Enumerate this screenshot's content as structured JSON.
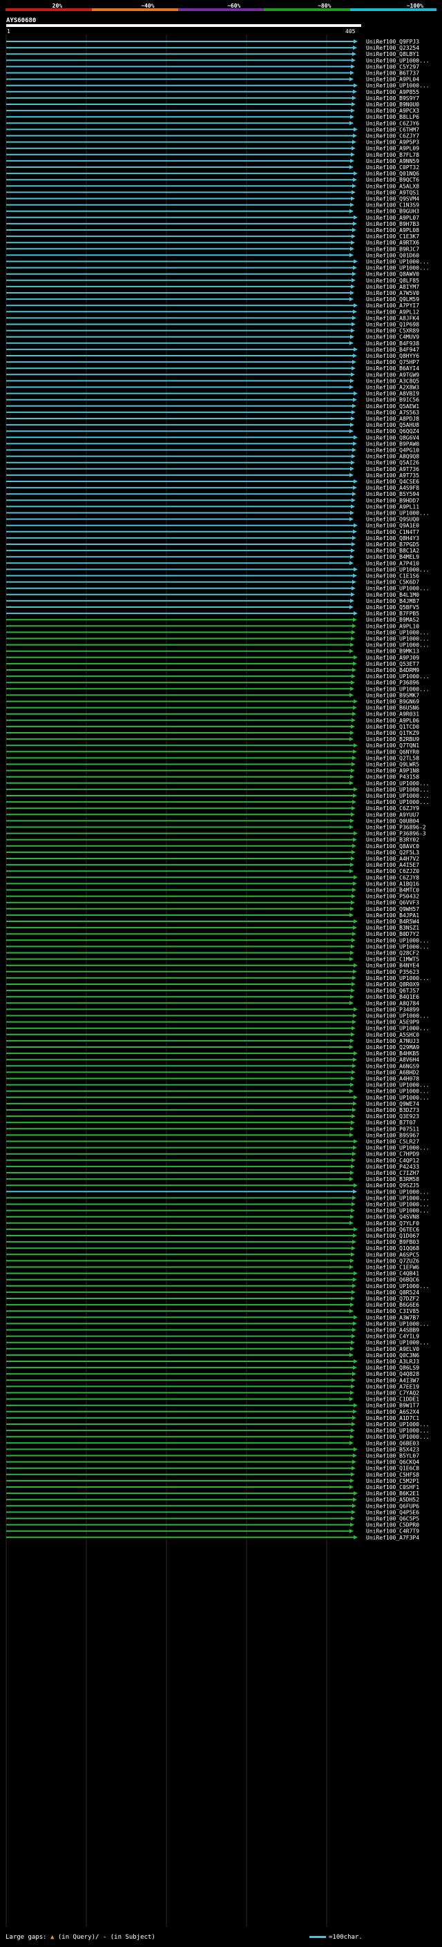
{
  "scale": {
    "labels": [
      "20%",
      "~40%",
      "~60%",
      "~80%",
      "~100%"
    ],
    "colors": [
      "#d01818",
      "#e07818",
      "#7a2aa8",
      "#18a018",
      "#18b8d8"
    ]
  },
  "query": {
    "name": "AYS60680",
    "start": "1",
    "end": "405"
  },
  "legend": {
    "text": "Large gaps:",
    "query_gap": "(in Query)/",
    "subject_gap": "- (in Subject)",
    "key": "=100char."
  },
  "hit_colors": {
    "high": "#4cc3d6",
    "mid": "#2bb83a"
  },
  "hits": [
    {
      "id": "UniRef100_Q9FPJ3",
      "c": "high"
    },
    {
      "id": "UniRef100_Q23254",
      "c": "high"
    },
    {
      "id": "UniRef100_Q8LBY1",
      "c": "high"
    },
    {
      "id": "UniRef100_UP1000...",
      "c": "high"
    },
    {
      "id": "UniRef100_C5Y297",
      "c": "high"
    },
    {
      "id": "UniRef100_B6T737",
      "c": "high"
    },
    {
      "id": "UniRef100_A9PL04",
      "c": "high"
    },
    {
      "id": "UniRef100_UP1000...",
      "c": "high"
    },
    {
      "id": "UniRef100_A9P855",
      "c": "high"
    },
    {
      "id": "UniRef100_B9S9Y7",
      "c": "high"
    },
    {
      "id": "UniRef100_B9N0U0",
      "c": "high"
    },
    {
      "id": "UniRef100_A9PCX3",
      "c": "high"
    },
    {
      "id": "UniRef100_B8LLP6",
      "c": "high"
    },
    {
      "id": "UniRef100_C6ZJY6",
      "c": "high"
    },
    {
      "id": "UniRef100_C6THM7",
      "c": "high"
    },
    {
      "id": "UniRef100_C6ZJY7",
      "c": "high"
    },
    {
      "id": "UniRef100_A9P5P3",
      "c": "high"
    },
    {
      "id": "UniRef100_A9PL09",
      "c": "high"
    },
    {
      "id": "UniRef100_B7FL78",
      "c": "high"
    },
    {
      "id": "UniRef100_A9NN59",
      "c": "high"
    },
    {
      "id": "UniRef100_C0PT32",
      "c": "high"
    },
    {
      "id": "UniRef100_Q01NQ6",
      "c": "high"
    },
    {
      "id": "UniRef100_B9QCT6",
      "c": "high"
    },
    {
      "id": "UniRef100_A5ALX8",
      "c": "high"
    },
    {
      "id": "UniRef100_A9TQS1",
      "c": "high"
    },
    {
      "id": "UniRef100_Q9SVM4",
      "c": "high"
    },
    {
      "id": "UniRef100_C1N3S9",
      "c": "high"
    },
    {
      "id": "UniRef100_B9GUH3",
      "c": "high"
    },
    {
      "id": "UniRef100_A9PL07",
      "c": "high"
    },
    {
      "id": "UniRef100_B9H7B3",
      "c": "high"
    },
    {
      "id": "UniRef100_A9PL08",
      "c": "high"
    },
    {
      "id": "UniRef100_C1E3K7",
      "c": "high"
    },
    {
      "id": "UniRef100_A9RTX6",
      "c": "high"
    },
    {
      "id": "UniRef100_B9RJC7",
      "c": "high"
    },
    {
      "id": "UniRef100_Q01D60",
      "c": "high"
    },
    {
      "id": "UniRef100_UP1000...",
      "c": "high"
    },
    {
      "id": "UniRef100_UP1000...",
      "c": "high"
    },
    {
      "id": "UniRef100_Q8AWV0",
      "c": "high"
    },
    {
      "id": "UniRef100_Q8LF85",
      "c": "high"
    },
    {
      "id": "UniRef100_A8IYM7",
      "c": "high"
    },
    {
      "id": "UniRef100_A7W5V0",
      "c": "high"
    },
    {
      "id": "UniRef100_Q9LM59",
      "c": "high"
    },
    {
      "id": "UniRef100_A7PYI7",
      "c": "high"
    },
    {
      "id": "UniRef100_A9PL12",
      "c": "high"
    },
    {
      "id": "UniRef100_A8JFK4",
      "c": "high"
    },
    {
      "id": "UniRef100_Q1P698",
      "c": "high"
    },
    {
      "id": "UniRef100_C5XR89",
      "c": "high"
    },
    {
      "id": "UniRef100_C4MUV9",
      "c": "high"
    },
    {
      "id": "UniRef100_B4F938",
      "c": "high"
    },
    {
      "id": "UniRef100_B4F947",
      "c": "high"
    },
    {
      "id": "UniRef100_Q8HYY6",
      "c": "high"
    },
    {
      "id": "UniRef100_Q75HP7",
      "c": "high"
    },
    {
      "id": "UniRef100_B6AYI4",
      "c": "high"
    },
    {
      "id": "UniRef100_A9TGW9",
      "c": "high"
    },
    {
      "id": "UniRef100_A3C8Q5",
      "c": "high"
    },
    {
      "id": "UniRef100_A2X8W3",
      "c": "high"
    },
    {
      "id": "UniRef100_A8VBI9",
      "c": "high"
    },
    {
      "id": "UniRef100_B9IC56",
      "c": "high"
    },
    {
      "id": "UniRef100_Q5AEW1",
      "c": "high"
    },
    {
      "id": "UniRef100_A7S563",
      "c": "high"
    },
    {
      "id": "UniRef100_A8PDJ8",
      "c": "high"
    },
    {
      "id": "UniRef100_Q5AHU8",
      "c": "high"
    },
    {
      "id": "UniRef100_Q6QQZ4",
      "c": "high"
    },
    {
      "id": "UniRef100_Q8G6V4",
      "c": "high"
    },
    {
      "id": "UniRef100_B9PAW0",
      "c": "high"
    },
    {
      "id": "UniRef100_Q4PG10",
      "c": "high"
    },
    {
      "id": "UniRef100_A8Q9Q8",
      "c": "high"
    },
    {
      "id": "UniRef100_Q5AI26",
      "c": "high"
    },
    {
      "id": "UniRef100_A9T736",
      "c": "high"
    },
    {
      "id": "UniRef100_A9T735",
      "c": "high"
    },
    {
      "id": "UniRef100_Q4CSE6",
      "c": "high"
    },
    {
      "id": "UniRef100_A4S9F8",
      "c": "high"
    },
    {
      "id": "UniRef100_B5Y594",
      "c": "high"
    },
    {
      "id": "UniRef100_B9HDD7",
      "c": "high"
    },
    {
      "id": "UniRef100_A9PL11",
      "c": "high"
    },
    {
      "id": "UniRef100_UP1000...",
      "c": "high"
    },
    {
      "id": "UniRef100_Q9SUQ0",
      "c": "high"
    },
    {
      "id": "UniRef100_Q9A1E0",
      "c": "high"
    },
    {
      "id": "UniRef100_C1N4T7",
      "c": "high"
    },
    {
      "id": "UniRef100_Q8H4Y3",
      "c": "high"
    },
    {
      "id": "UniRef100_B7PGD5",
      "c": "high"
    },
    {
      "id": "UniRef100_B8C1A2",
      "c": "high"
    },
    {
      "id": "UniRef100_B4MEL9",
      "c": "high"
    },
    {
      "id": "UniRef100_A7P410",
      "c": "high"
    },
    {
      "id": "UniRef100_UP1000...",
      "c": "high"
    },
    {
      "id": "UniRef100_C1E1S6",
      "c": "high"
    },
    {
      "id": "UniRef100_C5K6D7",
      "c": "high"
    },
    {
      "id": "UniRef100_UP1000...",
      "c": "high"
    },
    {
      "id": "UniRef100_B4L1M0",
      "c": "high"
    },
    {
      "id": "UniRef100_B4JM87",
      "c": "high"
    },
    {
      "id": "UniRef100_Q5BFV5",
      "c": "high"
    },
    {
      "id": "UniRef100_B7FPB5",
      "c": "high"
    },
    {
      "id": "UniRef100_B9MAS2",
      "c": "mid"
    },
    {
      "id": "UniRef100_A9PL10",
      "c": "mid"
    },
    {
      "id": "UniRef100_UP1000...",
      "c": "mid"
    },
    {
      "id": "UniRef100_UP1000...",
      "c": "mid"
    },
    {
      "id": "UniRef100_UP1000...",
      "c": "mid"
    },
    {
      "id": "UniRef100_B9MK13",
      "c": "mid"
    },
    {
      "id": "UniRef100_A9PJ09",
      "c": "mid"
    },
    {
      "id": "UniRef100_Q53ET7",
      "c": "mid"
    },
    {
      "id": "UniRef100_B4DRM9",
      "c": "mid"
    },
    {
      "id": "UniRef100_UP1000...",
      "c": "mid"
    },
    {
      "id": "UniRef100_P36896",
      "c": "mid"
    },
    {
      "id": "UniRef100_UP1000...",
      "c": "mid"
    },
    {
      "id": "UniRef100_B9SMK7",
      "c": "mid"
    },
    {
      "id": "UniRef100_B9GN69",
      "c": "mid"
    },
    {
      "id": "UniRef100_B6U5N6",
      "c": "mid"
    },
    {
      "id": "UniRef100_A9R031",
      "c": "mid"
    },
    {
      "id": "UniRef100_A9PL06",
      "c": "mid"
    },
    {
      "id": "UniRef100_Q1TCD0",
      "c": "mid"
    },
    {
      "id": "UniRef100_Q1TKZ9",
      "c": "mid"
    },
    {
      "id": "UniRef100_B2RBU9",
      "c": "mid"
    },
    {
      "id": "UniRef100_Q7TQN1",
      "c": "mid"
    },
    {
      "id": "UniRef100_Q6NYR0",
      "c": "mid"
    },
    {
      "id": "UniRef100_Q2TL58",
      "c": "mid"
    },
    {
      "id": "UniRef100_Q9LWR5",
      "c": "mid"
    },
    {
      "id": "UniRef100_A9P1N8",
      "c": "mid"
    },
    {
      "id": "UniRef100_P43158",
      "c": "mid"
    },
    {
      "id": "UniRef100_UP1000...",
      "c": "mid"
    },
    {
      "id": "UniRef100_UP1000...",
      "c": "mid"
    },
    {
      "id": "UniRef100_UP1000...",
      "c": "mid"
    },
    {
      "id": "UniRef100_UP1000...",
      "c": "mid"
    },
    {
      "id": "UniRef100_C6ZJY9",
      "c": "mid"
    },
    {
      "id": "UniRef100_A9YUU7",
      "c": "mid"
    },
    {
      "id": "UniRef100_Q0UB04",
      "c": "mid"
    },
    {
      "id": "UniRef100_P36896-2",
      "c": "mid"
    },
    {
      "id": "UniRef100_P36896-3",
      "c": "mid"
    },
    {
      "id": "UniRef100_B3RY02",
      "c": "mid"
    },
    {
      "id": "UniRef100_Q8AVC0",
      "c": "mid"
    },
    {
      "id": "UniRef100_Q2F5L3",
      "c": "mid"
    },
    {
      "id": "UniRef100_A4H7V2",
      "c": "mid"
    },
    {
      "id": "UniRef100_A4I5E7",
      "c": "mid"
    },
    {
      "id": "UniRef100_C6ZJZ0",
      "c": "mid"
    },
    {
      "id": "UniRef100_C6ZJY8",
      "c": "mid"
    },
    {
      "id": "UniRef100_A1BQ16",
      "c": "mid"
    },
    {
      "id": "UniRef100_B4MTC0",
      "c": "mid"
    },
    {
      "id": "UniRef100_P50432",
      "c": "mid"
    },
    {
      "id": "UniRef100_Q6VVF3",
      "c": "mid"
    },
    {
      "id": "UniRef100_Q9WH57",
      "c": "mid"
    },
    {
      "id": "UniRef100_B4JPA1",
      "c": "mid"
    },
    {
      "id": "UniRef100_B4R5W4",
      "c": "mid"
    },
    {
      "id": "UniRef100_B3NSZ1",
      "c": "mid"
    },
    {
      "id": "UniRef100_B0D7Y2",
      "c": "mid"
    },
    {
      "id": "UniRef100_UP1000...",
      "c": "mid"
    },
    {
      "id": "UniRef100_UP1000...",
      "c": "mid"
    },
    {
      "id": "UniRef100_Q28CF2",
      "c": "mid"
    },
    {
      "id": "UniRef100_C1MWT5",
      "c": "mid"
    },
    {
      "id": "UniRef100_B4NYE4",
      "c": "mid"
    },
    {
      "id": "UniRef100_P35623",
      "c": "mid"
    },
    {
      "id": "UniRef100_UP1000...",
      "c": "mid"
    },
    {
      "id": "UniRef100_Q8R0X9",
      "c": "mid"
    },
    {
      "id": "UniRef100_Q6TJS7",
      "c": "mid"
    },
    {
      "id": "UniRef100_B4Q1E6",
      "c": "mid"
    },
    {
      "id": "UniRef100_A8Q784",
      "c": "mid"
    },
    {
      "id": "UniRef100_P34899",
      "c": "mid"
    },
    {
      "id": "UniRef100_UP1000...",
      "c": "mid"
    },
    {
      "id": "UniRef100_A5E9P9",
      "c": "mid"
    },
    {
      "id": "UniRef100_UP1000...",
      "c": "mid"
    },
    {
      "id": "UniRef100_A5SHC0",
      "c": "mid"
    },
    {
      "id": "UniRef100_A7NUJ3",
      "c": "mid"
    },
    {
      "id": "UniRef100_Q29MA9",
      "c": "mid"
    },
    {
      "id": "UniRef100_B4HKB5",
      "c": "mid"
    },
    {
      "id": "UniRef100_A8V6H4",
      "c": "mid"
    },
    {
      "id": "UniRef100_A6NGS9",
      "c": "mid"
    },
    {
      "id": "UniRef100_A6BHD2",
      "c": "mid"
    },
    {
      "id": "UniRef100_A4H078",
      "c": "mid"
    },
    {
      "id": "UniRef100_UP1000...",
      "c": "mid"
    },
    {
      "id": "UniRef100_UP1000...",
      "c": "mid"
    },
    {
      "id": "UniRef100_UP1000...",
      "c": "mid"
    },
    {
      "id": "UniRef100_Q9WE74",
      "c": "mid"
    },
    {
      "id": "UniRef100_B3DZ73",
      "c": "mid"
    },
    {
      "id": "UniRef100_Q3E923",
      "c": "mid"
    },
    {
      "id": "UniRef100_B7T07",
      "c": "mid"
    },
    {
      "id": "UniRef100_P07511",
      "c": "mid"
    },
    {
      "id": "UniRef100_B9S967",
      "c": "mid"
    },
    {
      "id": "UniRef100_C5LR27",
      "c": "mid"
    },
    {
      "id": "UniRef100_UP1000...",
      "c": "mid"
    },
    {
      "id": "UniRef100_C7HPD9",
      "c": "mid"
    },
    {
      "id": "UniRef100_C4QP12",
      "c": "mid"
    },
    {
      "id": "UniRef100_P42433",
      "c": "mid"
    },
    {
      "id": "UniRef100_C7IZH7",
      "c": "mid"
    },
    {
      "id": "UniRef100_B3RM58",
      "c": "mid"
    },
    {
      "id": "UniRef100_Q9SZJ5",
      "c": "mid"
    },
    {
      "id": "UniRef100_UP1000...",
      "c": "high"
    },
    {
      "id": "UniRef100_UP1000...",
      "c": "mid"
    },
    {
      "id": "UniRef100_UP1000...",
      "c": "mid"
    },
    {
      "id": "UniRef100_UP1000...",
      "c": "mid"
    },
    {
      "id": "UniRef100_Q4SVN8",
      "c": "mid"
    },
    {
      "id": "UniRef100_Q7YLF0",
      "c": "mid"
    },
    {
      "id": "UniRef100_Q6TEC6",
      "c": "mid"
    },
    {
      "id": "UniRef100_Q1D067",
      "c": "mid"
    },
    {
      "id": "UniRef100_B9FB03",
      "c": "mid"
    },
    {
      "id": "UniRef100_Q1QQ68",
      "c": "mid"
    },
    {
      "id": "UniRef100_A6SPC5",
      "c": "mid"
    },
    {
      "id": "UniRef100_Q7ZUZ6",
      "c": "mid"
    },
    {
      "id": "UniRef100_C1EFW6",
      "c": "mid"
    },
    {
      "id": "UniRef100_C4QB41",
      "c": "mid"
    },
    {
      "id": "UniRef100_Q6BQC6",
      "c": "mid"
    },
    {
      "id": "UniRef100_UP1000...",
      "c": "mid"
    },
    {
      "id": "UniRef100_Q8R524",
      "c": "mid"
    },
    {
      "id": "UniRef100_Q7DZF2",
      "c": "mid"
    },
    {
      "id": "UniRef100_B6G6E6",
      "c": "mid"
    },
    {
      "id": "UniRef100_C3IV85",
      "c": "mid"
    },
    {
      "id": "UniRef100_A3W7B7",
      "c": "mid"
    },
    {
      "id": "UniRef100_UP1000...",
      "c": "mid"
    },
    {
      "id": "UniRef100_A4SBB9",
      "c": "mid"
    },
    {
      "id": "UniRef100_C4YIL9",
      "c": "mid"
    },
    {
      "id": "UniRef100_UP1000...",
      "c": "mid"
    },
    {
      "id": "UniRef100_A9ELV0",
      "c": "mid"
    },
    {
      "id": "UniRef100_Q0C3N6",
      "c": "mid"
    },
    {
      "id": "UniRef100_A3LRJ3",
      "c": "mid"
    },
    {
      "id": "UniRef100_Q86LS9",
      "c": "mid"
    },
    {
      "id": "UniRef100_Q4Q828",
      "c": "mid"
    },
    {
      "id": "UniRef100_A4I3W7",
      "c": "mid"
    },
    {
      "id": "UniRef100_A7EE19",
      "c": "mid"
    },
    {
      "id": "UniRef100_C7YAQ2",
      "c": "mid"
    },
    {
      "id": "UniRef100_C1DDE1",
      "c": "mid"
    },
    {
      "id": "UniRef100_B9W1T7",
      "c": "mid"
    },
    {
      "id": "UniRef100_A6S2X4",
      "c": "mid"
    },
    {
      "id": "UniRef100_A1D7C1",
      "c": "mid"
    },
    {
      "id": "UniRef100_UP1000...",
      "c": "mid"
    },
    {
      "id": "UniRef100_UP1000...",
      "c": "mid"
    },
    {
      "id": "UniRef100_UP1000...",
      "c": "mid"
    },
    {
      "id": "UniRef100_Q6BE03",
      "c": "mid"
    },
    {
      "id": "UniRef100_B5X423",
      "c": "mid"
    },
    {
      "id": "UniRef100_B5YL07",
      "c": "mid"
    },
    {
      "id": "UniRef100_Q6CKQ4",
      "c": "mid"
    },
    {
      "id": "UniRef100_Q1E6C8",
      "c": "mid"
    },
    {
      "id": "UniRef100_C5HFS8",
      "c": "mid"
    },
    {
      "id": "UniRef100_C5M2P1",
      "c": "mid"
    },
    {
      "id": "UniRef100_C0SHF1",
      "c": "mid"
    },
    {
      "id": "UniRef100_B6K2E1",
      "c": "mid"
    },
    {
      "id": "UniRef100_A5DH52",
      "c": "mid"
    },
    {
      "id": "UniRef100_Q6FUP6",
      "c": "mid"
    },
    {
      "id": "UniRef100_Q4P5E6",
      "c": "mid"
    },
    {
      "id": "UniRef100_Q6C5P5",
      "c": "mid"
    },
    {
      "id": "UniRef100_C5DPR0",
      "c": "mid"
    },
    {
      "id": "UniRef100_C4R7T9",
      "c": "mid"
    },
    {
      "id": "UniRef100_A7F3P4",
      "c": "mid"
    }
  ]
}
